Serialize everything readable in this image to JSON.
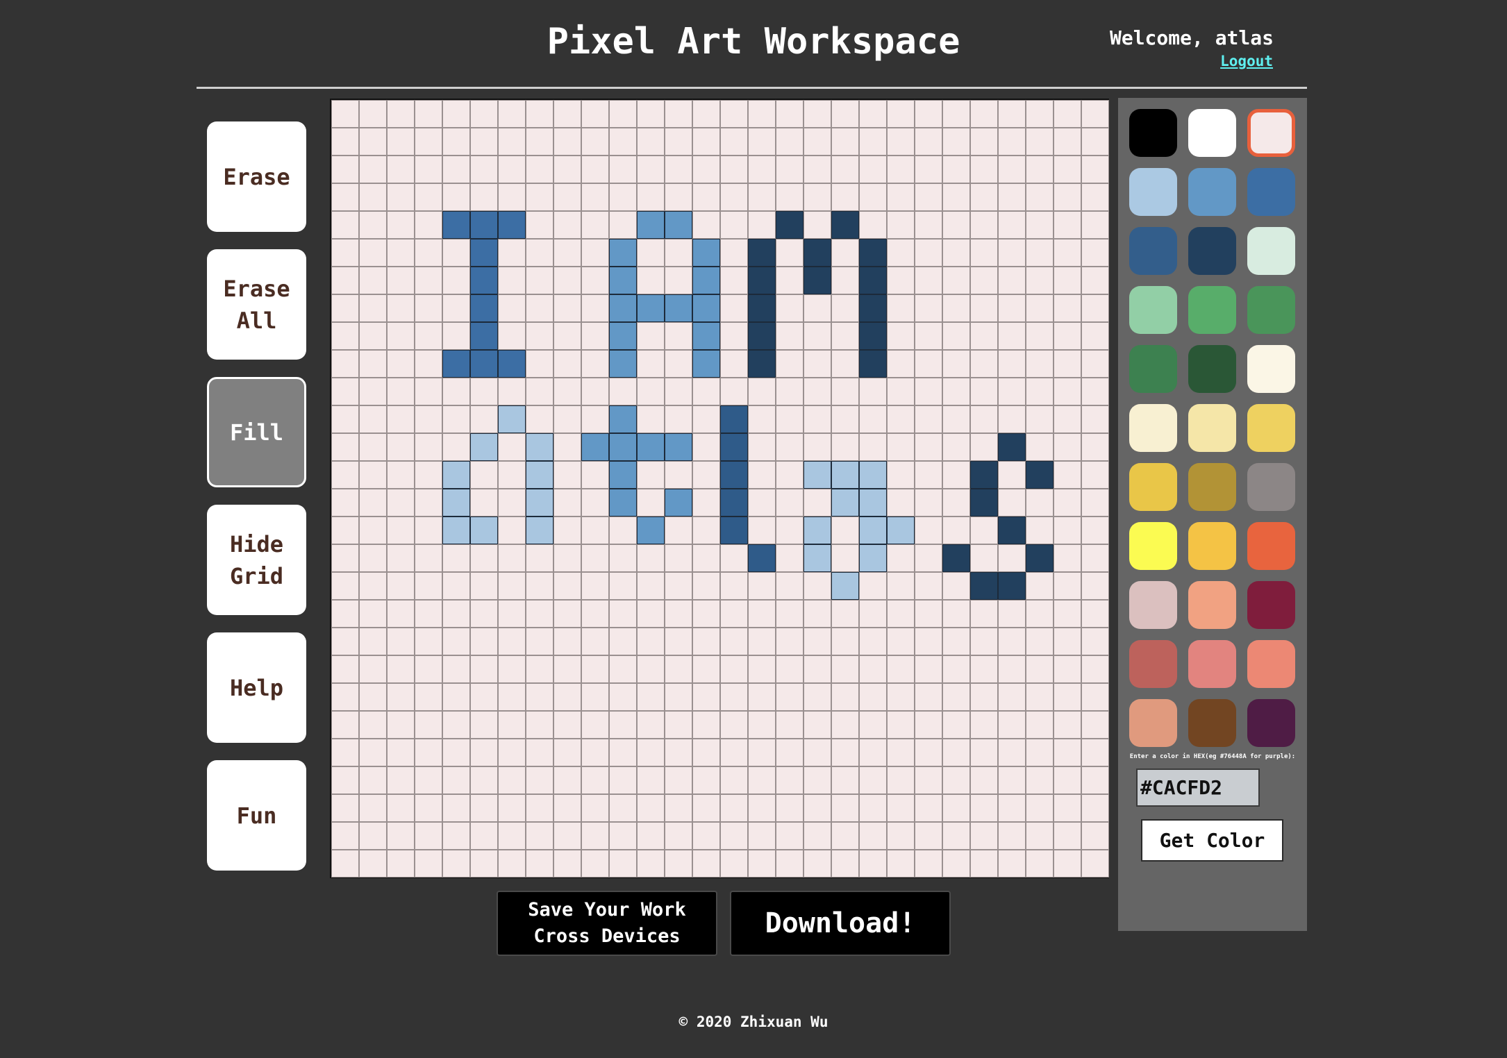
{
  "header": {
    "title": "Pixel Art Workspace",
    "welcome": "Welcome, atlas",
    "logout": "Logout"
  },
  "tools": [
    {
      "label": "Erase",
      "active": false
    },
    {
      "label": "Erase\nAll",
      "active": false
    },
    {
      "label": "Fill",
      "active": true
    },
    {
      "label": "Hide\nGrid",
      "active": false
    },
    {
      "label": "Help",
      "active": false
    },
    {
      "label": "Fun",
      "active": false
    }
  ],
  "canvas": {
    "columns": 28,
    "rows": 28,
    "background": "#f5e9e9",
    "grid_line_color": "#9a9090",
    "pixels": [
      {
        "color": "#3c6ea4",
        "cells": [
          [
            4,
            4
          ],
          [
            5,
            4
          ],
          [
            6,
            4
          ],
          [
            5,
            5
          ],
          [
            5,
            6
          ],
          [
            5,
            7
          ],
          [
            5,
            8
          ],
          [
            4,
            9
          ],
          [
            5,
            9
          ],
          [
            6,
            9
          ]
        ]
      },
      {
        "color": "#6298c6",
        "cells": [
          [
            11,
            4
          ],
          [
            12,
            4
          ],
          [
            10,
            5
          ],
          [
            13,
            5
          ],
          [
            10,
            6
          ],
          [
            13,
            6
          ],
          [
            10,
            7
          ],
          [
            11,
            7
          ],
          [
            12,
            7
          ],
          [
            13,
            7
          ],
          [
            10,
            8
          ],
          [
            13,
            8
          ],
          [
            10,
            9
          ],
          [
            13,
            9
          ]
        ]
      },
      {
        "color": "#22405e",
        "cells": [
          [
            16,
            4
          ],
          [
            18,
            4
          ],
          [
            15,
            5
          ],
          [
            17,
            5
          ],
          [
            19,
            5
          ],
          [
            15,
            6
          ],
          [
            17,
            6
          ],
          [
            19,
            6
          ],
          [
            15,
            7
          ],
          [
            19,
            7
          ],
          [
            15,
            8
          ],
          [
            19,
            8
          ],
          [
            15,
            9
          ],
          [
            19,
            9
          ]
        ]
      },
      {
        "color": "#a9c6e0",
        "cells": [
          [
            6,
            11
          ],
          [
            5,
            12
          ],
          [
            7,
            12
          ],
          [
            4,
            13
          ],
          [
            7,
            13
          ],
          [
            4,
            14
          ],
          [
            7,
            14
          ],
          [
            4,
            15
          ],
          [
            5,
            15
          ],
          [
            7,
            15
          ],
          [
            17,
            13
          ],
          [
            18,
            13
          ],
          [
            19,
            13
          ],
          [
            18,
            14
          ],
          [
            19,
            14
          ],
          [
            17,
            15
          ],
          [
            19,
            15
          ],
          [
            20,
            15
          ],
          [
            17,
            16
          ],
          [
            19,
            16
          ],
          [
            18,
            17
          ]
        ]
      },
      {
        "color": "#6298c6",
        "cells": [
          [
            10,
            11
          ],
          [
            9,
            12
          ],
          [
            10,
            12
          ],
          [
            11,
            12
          ],
          [
            12,
            12
          ],
          [
            10,
            13
          ],
          [
            10,
            14
          ],
          [
            12,
            14
          ],
          [
            11,
            15
          ]
        ]
      },
      {
        "color": "#2f5b89",
        "cells": [
          [
            14,
            11
          ],
          [
            14,
            12
          ],
          [
            14,
            13
          ],
          [
            14,
            14
          ],
          [
            14,
            15
          ],
          [
            15,
            16
          ]
        ]
      },
      {
        "color": "#22405e",
        "cells": [
          [
            24,
            12
          ],
          [
            23,
            13
          ],
          [
            25,
            13
          ],
          [
            23,
            14
          ],
          [
            24,
            15
          ],
          [
            22,
            16
          ],
          [
            25,
            16
          ],
          [
            23,
            17
          ],
          [
            24,
            17
          ]
        ]
      }
    ]
  },
  "palette": {
    "selected_index": 2,
    "colors": [
      "#000000",
      "#ffffff",
      "#f5e9e9",
      "#abc9e3",
      "#6298c6",
      "#3c6ea4",
      "#335e8b",
      "#22405e",
      "#d8ece0",
      "#92cfa6",
      "#58ad6a",
      "#4a955a",
      "#3d8150",
      "#2a5736",
      "#fbf6e6",
      "#f8f0d2",
      "#f5e6a8",
      "#eed160",
      "#e9c648",
      "#b29336",
      "#8c8686",
      "#fbfb52",
      "#f4c345",
      "#e8643e",
      "#dbc0bf",
      "#f1a282",
      "#7f1d3c",
      "#bd625c",
      "#e2847f",
      "#ec8874",
      "#e09a7e",
      "#724522",
      "#4f1c45"
    ],
    "hex_hint": "Enter a color in HEX(eg #76448A for purple):",
    "hex_value": "#CACFD2",
    "get_color_label": "Get Color"
  },
  "actions": {
    "save_label": "Save Your Work\nCross Devices",
    "download_label": "Download!"
  },
  "footer": {
    "text": "© 2020 Zhixuan Wu"
  }
}
